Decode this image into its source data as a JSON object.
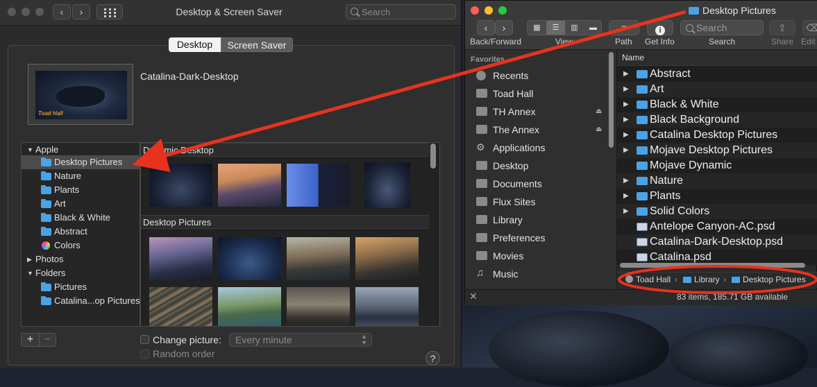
{
  "sysprefs": {
    "title": "Desktop & Screen Saver",
    "search_placeholder": "Search",
    "tabs": [
      "Desktop",
      "Screen Saver"
    ],
    "preview_name": "Catalina-Dark-Desktop",
    "preview_watermark": "Toad Hall",
    "source_list": [
      {
        "label": "Apple",
        "kind": "group",
        "expanded": true
      },
      {
        "label": "Desktop Pictures",
        "kind": "folder",
        "selected": true
      },
      {
        "label": "Nature",
        "kind": "folder"
      },
      {
        "label": "Plants",
        "kind": "folder"
      },
      {
        "label": "Art",
        "kind": "folder"
      },
      {
        "label": "Black & White",
        "kind": "folder"
      },
      {
        "label": "Abstract",
        "kind": "folder"
      },
      {
        "label": "Colors",
        "kind": "colors"
      },
      {
        "label": "Photos",
        "kind": "group",
        "expanded": false
      },
      {
        "label": "Folders",
        "kind": "group",
        "expanded": true
      },
      {
        "label": "Pictures",
        "kind": "folder"
      },
      {
        "label": "Catalina...op Pictures",
        "kind": "folder"
      }
    ],
    "sections": [
      "Dynamic Desktop",
      "Desktop Pictures"
    ],
    "add_label": "+",
    "remove_label": "−",
    "change_picture_label": "Change picture:",
    "change_picture_interval": "Every minute",
    "random_order_label": "Random order",
    "help_label": "?"
  },
  "finder": {
    "title": "Desktop Pictures",
    "toolbar": {
      "back_forward_label": "Back/Forward",
      "view_label": "View",
      "path_label": "Path",
      "get_info_label": "Get Info",
      "search_label": "Search",
      "search_placeholder": "Search",
      "share_label": "Share",
      "edit_label": "Edit"
    },
    "sidebar_heading": "Favorites",
    "sidebar": [
      {
        "label": "Recents",
        "eject": false
      },
      {
        "label": "Toad Hall",
        "eject": false
      },
      {
        "label": "TH Annex",
        "eject": true
      },
      {
        "label": "The Annex",
        "eject": true
      },
      {
        "label": "Applications",
        "eject": false
      },
      {
        "label": "Desktop",
        "eject": false
      },
      {
        "label": "Documents",
        "eject": false
      },
      {
        "label": "Flux Sites",
        "eject": false
      },
      {
        "label": "Library",
        "eject": false
      },
      {
        "label": "Preferences",
        "eject": false
      },
      {
        "label": "Movies",
        "eject": false
      },
      {
        "label": "Music",
        "eject": false
      }
    ],
    "column_name": "Name",
    "files": [
      {
        "name": "Abstract",
        "folder": true,
        "expandable": true
      },
      {
        "name": "Art",
        "folder": true,
        "expandable": true
      },
      {
        "name": "Black & White",
        "folder": true,
        "expandable": true
      },
      {
        "name": "Black Background",
        "folder": true,
        "expandable": true
      },
      {
        "name": "Catalina Desktop Pictures",
        "folder": true,
        "expandable": true
      },
      {
        "name": "Mojave Desktop Pictures",
        "folder": true,
        "expandable": true
      },
      {
        "name": "Mojave Dynamic",
        "folder": true,
        "expandable": false
      },
      {
        "name": "Nature",
        "folder": true,
        "expandable": true
      },
      {
        "name": "Plants",
        "folder": true,
        "expandable": true
      },
      {
        "name": "Solid Colors",
        "folder": true,
        "expandable": true
      },
      {
        "name": "Antelope Canyon-AC.psd",
        "folder": false,
        "expandable": false
      },
      {
        "name": "Catalina-Dark-Desktop.psd",
        "folder": false,
        "expandable": false
      },
      {
        "name": "Catalina.psd",
        "folder": false,
        "expandable": false
      }
    ],
    "path": [
      "Toad Hall",
      "Library",
      "Desktop Pictures"
    ],
    "path_separator": "›",
    "status": "83 items, 185.71 GB available"
  },
  "colors": {
    "accent_folder": "#4aa3e6",
    "annotation_red": "#e8321e",
    "close": "#ff5f57",
    "minimize": "#febc2e",
    "zoom": "#28c840"
  }
}
